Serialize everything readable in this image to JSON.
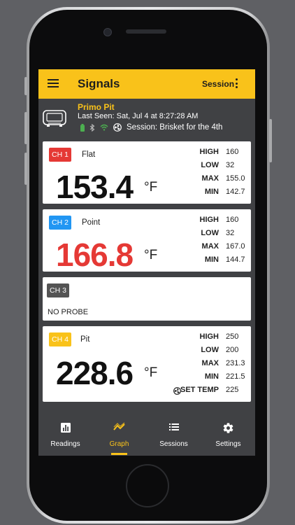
{
  "app_bar": {
    "title": "Signals",
    "session_label": "Session"
  },
  "device": {
    "name": "Primo Pit",
    "last_seen": "Last Seen: Sat, Jul 4 at 8:27:28 AM",
    "session": "Session: Brisket for the 4th"
  },
  "channels": [
    {
      "badge": "CH 1",
      "badge_color": "#e53935",
      "name": "Flat",
      "temp": "153.4",
      "temp_color": "#111111",
      "unit": "°F",
      "stats": [
        {
          "label": "HIGH",
          "value": "160"
        },
        {
          "label": "LOW",
          "value": "32"
        },
        {
          "label": "MAX",
          "value": "155.0"
        },
        {
          "label": "MIN",
          "value": "142.7"
        }
      ]
    },
    {
      "badge": "CH 2",
      "badge_color": "#2196f3",
      "name": "Point",
      "temp": "166.8",
      "temp_color": "#e53935",
      "unit": "°F",
      "stats": [
        {
          "label": "HIGH",
          "value": "160"
        },
        {
          "label": "LOW",
          "value": "32"
        },
        {
          "label": "MAX",
          "value": "167.0"
        },
        {
          "label": "MIN",
          "value": "144.7"
        }
      ]
    },
    {
      "badge": "CH 3",
      "badge_color": "#545454",
      "status": "NO PROBE"
    },
    {
      "badge": "CH 4",
      "badge_color": "#f9c21a",
      "name": "Pit",
      "temp": "228.6",
      "temp_color": "#111111",
      "unit": "°F",
      "stats": [
        {
          "label": "HIGH",
          "value": "250"
        },
        {
          "label": "LOW",
          "value": "200"
        },
        {
          "label": "MAX",
          "value": "231.3"
        },
        {
          "label": "MIN",
          "value": "221.5"
        },
        {
          "label": "SET TEMP",
          "value": "225"
        }
      ]
    }
  ],
  "nav": [
    {
      "label": "Readings",
      "icon": "bar-chart-icon"
    },
    {
      "label": "Graph",
      "icon": "line-graph-icon",
      "active": true
    },
    {
      "label": "Sessions",
      "icon": "list-icon"
    },
    {
      "label": "Settings",
      "icon": "gear-icon"
    }
  ],
  "colors": {
    "accent": "#f9c21a",
    "dark": "#404144",
    "alarm": "#e53935"
  }
}
